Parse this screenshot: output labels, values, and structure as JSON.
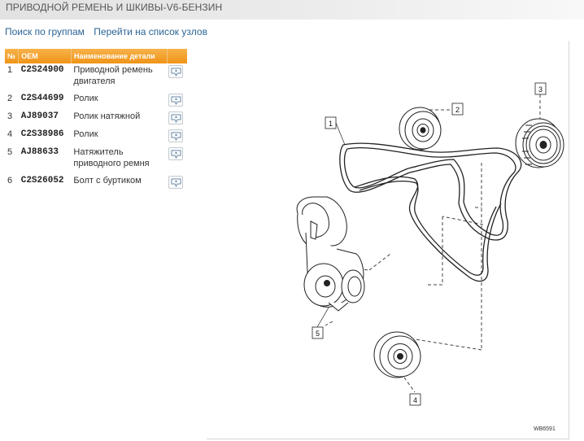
{
  "page": {
    "title": "ПРИВОДНОЙ РЕМЕНЬ И ШКИВЫ-V6-БЕНЗИН"
  },
  "nav": {
    "search_by_groups": "Поиск по группам",
    "go_to_units_list": "Перейти на список узлов"
  },
  "table": {
    "headers": {
      "num": "№",
      "oem": "OEM",
      "name": "Наименование детали",
      "action": ""
    },
    "rows": [
      {
        "num": "1",
        "oem": "C2S24900",
        "name": "Приводной ремень двигателя"
      },
      {
        "num": "2",
        "oem": "C2S44699",
        "name": "Ролик"
      },
      {
        "num": "3",
        "oem": "AJ89037",
        "name": "Ролик натяжной"
      },
      {
        "num": "4",
        "oem": "C2S38986",
        "name": "Ролик"
      },
      {
        "num": "5",
        "oem": "AJ88633",
        "name": "Натяжитель приводного ремня"
      },
      {
        "num": "6",
        "oem": "C2S26052",
        "name": "Болт с буртиком"
      }
    ]
  },
  "diagram": {
    "callouts": [
      "1",
      "2",
      "3",
      "4",
      "5"
    ],
    "code": "WB6591"
  },
  "colors": {
    "header_orange": "#ef9418",
    "link_blue": "#2a6496"
  },
  "icons": {
    "row_action": "tag-icon"
  }
}
